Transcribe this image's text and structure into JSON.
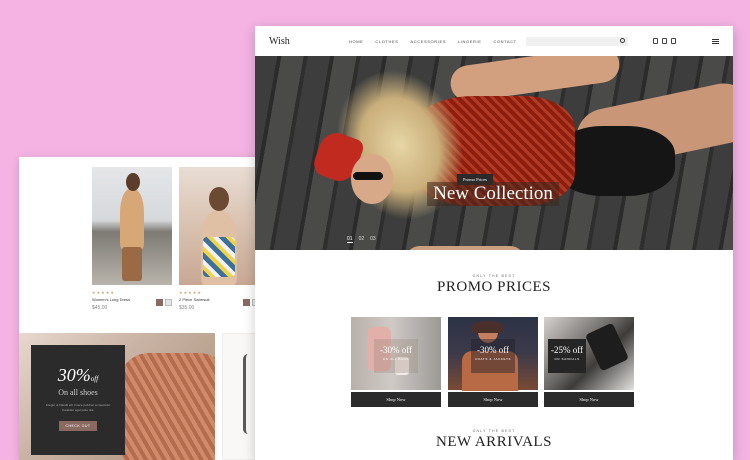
{
  "back_page": {
    "products": [
      {
        "name": "Women's Long Dress",
        "price": "$45.00",
        "stars": "★★★★★"
      },
      {
        "name": "2 Piece Swimsuit",
        "price": "$35.00",
        "stars": "★★★★★"
      }
    ],
    "banner": {
      "big": "30%",
      "big_suffix": "off",
      "sub": "On all shoes",
      "desc": "Integer ut blandit elit. Fusce pulvinar consectetur Curabitur eget justo nisl.",
      "button": "CHECK OUT"
    }
  },
  "nav": {
    "logo": "Wish",
    "menu": [
      "HOME",
      "CLOTHES",
      "ACCESSORIES",
      "LINGERIE",
      "CONTACT"
    ]
  },
  "hero": {
    "label": "Promo Prices",
    "title": "New Collection",
    "slides": [
      "01",
      "02",
      "03"
    ]
  },
  "promo_section": {
    "eyebrow": "ONLY THE BEST",
    "title": "PROMO PRICES",
    "cards": [
      {
        "pct": "-30% off",
        "what": "ON ALL BAGS",
        "button": "Shop Now"
      },
      {
        "pct": "-30% off",
        "what": "COATS & JACKETS",
        "button": "Shop Now"
      },
      {
        "pct": "-25% off",
        "what": "ON SANDALS",
        "button": "Shop Now"
      }
    ]
  },
  "arrivals_section": {
    "eyebrow": "ONLY THE BEST",
    "title": "NEW ARRIVALS"
  }
}
